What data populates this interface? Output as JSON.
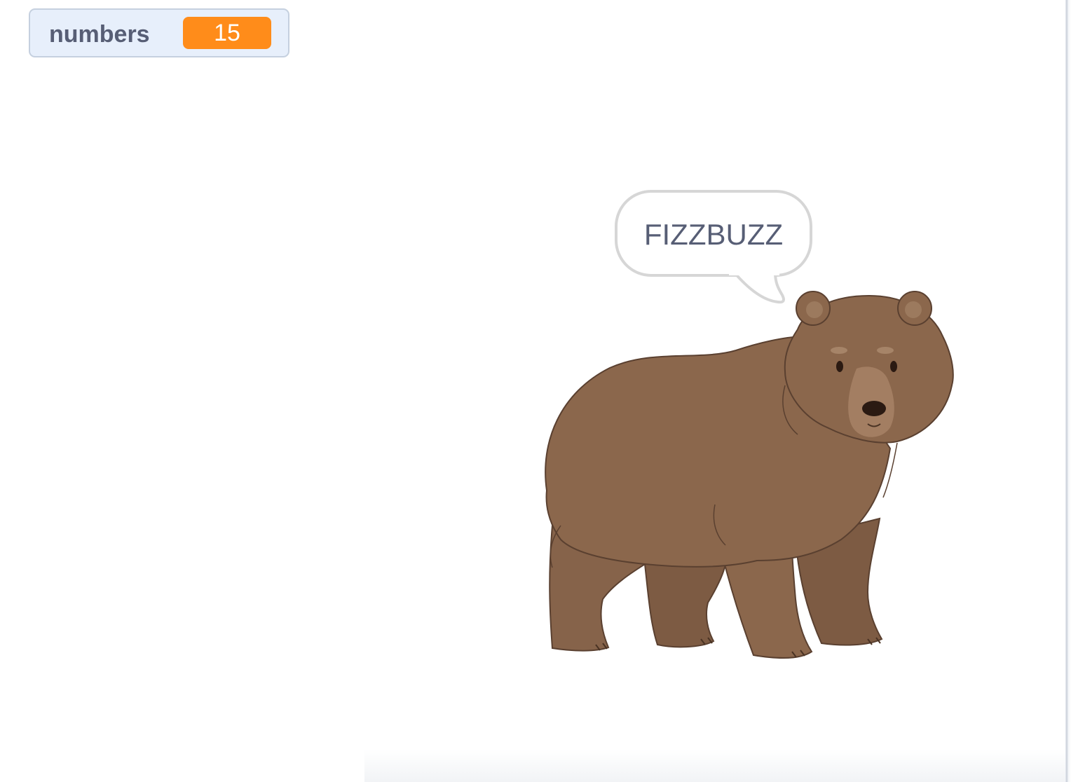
{
  "monitor": {
    "label": "numbers",
    "value": "15"
  },
  "sprite": {
    "speech": "FIZZBUZZ",
    "name": "bear-sprite"
  },
  "colors": {
    "monitor_value_bg": "#ff8c1a",
    "monitor_bg": "#e7effb",
    "text": "#575e75",
    "bear_body": "#8b674c"
  }
}
